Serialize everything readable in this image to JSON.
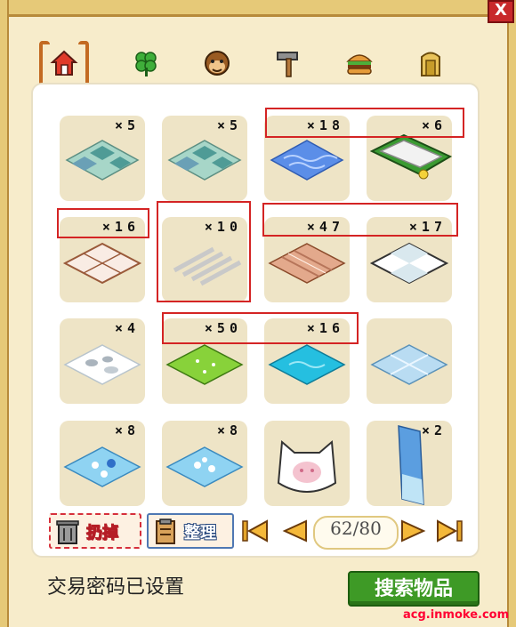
{
  "window": {
    "close_label": "X"
  },
  "tabs": [
    {
      "icon": "house-icon",
      "active": true
    },
    {
      "icon": "clover-icon",
      "active": false
    },
    {
      "icon": "monkey-face-icon",
      "active": false
    },
    {
      "icon": "hammer-icon",
      "active": false
    },
    {
      "icon": "burger-icon",
      "active": false
    },
    {
      "icon": "gate-icon",
      "active": false
    }
  ],
  "items": [
    {
      "qty": "×5",
      "icon": "teal-stone-tile-icon"
    },
    {
      "qty": "×5",
      "icon": "teal-stone-tile-icon"
    },
    {
      "qty": "×18",
      "icon": "blue-wave-tile-icon"
    },
    {
      "qty": "×6",
      "icon": "flower-bed-icon"
    },
    {
      "qty": "×16",
      "icon": "wood-frame-tile-icon"
    },
    {
      "qty": "×10",
      "icon": "white-stripe-tile-icon"
    },
    {
      "qty": "×47",
      "icon": "wood-plank-tile-icon"
    },
    {
      "qty": "×17",
      "icon": "checker-tile-icon"
    },
    {
      "qty": "×4",
      "icon": "snow-rock-tile-icon"
    },
    {
      "qty": "×50",
      "icon": "grass-tile-icon"
    },
    {
      "qty": "×16",
      "icon": "pool-water-tile-icon"
    },
    {
      "qty": "",
      "icon": "ice-glass-tile-icon"
    },
    {
      "qty": "×8",
      "icon": "blue-flower-tile-icon"
    },
    {
      "qty": "×8",
      "icon": "blue-flower-tile-icon"
    },
    {
      "qty": "",
      "icon": "cat-cushion-icon"
    },
    {
      "qty": "×2",
      "icon": "waterfall-wall-icon"
    }
  ],
  "actions": {
    "discard_label": "扔掉",
    "organize_label": "整理"
  },
  "pager": {
    "current": "62",
    "separator": "/",
    "total": "80"
  },
  "footer": {
    "password_status": "交易密码已设置",
    "search_label": "搜索物品",
    "watermark": "acg.inmoke.com"
  },
  "colors": {
    "highlight": "#d42424",
    "search_green": "#3e9a26",
    "frame_gold": "#e6c978"
  }
}
